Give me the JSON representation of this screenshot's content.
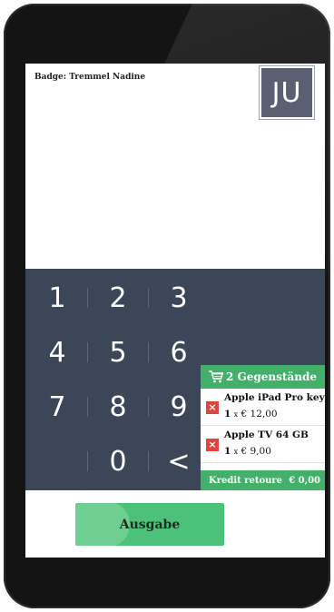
{
  "header": {
    "badge": "Badge: Tremmel Nadine",
    "logo_text": "JU"
  },
  "keypad": {
    "keys": [
      "1",
      "2",
      "3",
      "4",
      "5",
      "6",
      "7",
      "8",
      "9",
      "0",
      "<"
    ]
  },
  "cart": {
    "title": "2 Gegenstände",
    "items": [
      {
        "name": "Apple iPad Pro key",
        "qty": "1",
        "times": "x",
        "price": "€ 12,00"
      },
      {
        "name": "Apple TV 64 GB",
        "qty": "1",
        "times": "x",
        "price": "€ 9,00"
      }
    ],
    "remove_glyph": "×",
    "footer_label": "Kredit retoure",
    "footer_amount": "€ 0,00"
  },
  "action": {
    "label": "Ausgabe"
  },
  "colors": {
    "accent": "#43b06a",
    "keypad": "#3c4659",
    "remove": "#e0453d",
    "logo": "#5a6072"
  }
}
